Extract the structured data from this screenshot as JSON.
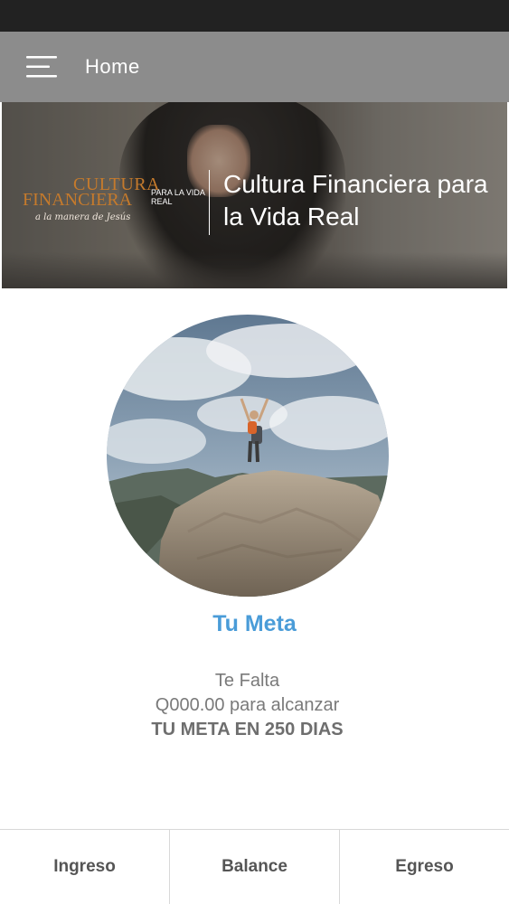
{
  "header": {
    "title": "Home",
    "menu_icon": "hamburger-menu-icon"
  },
  "banner": {
    "logo": {
      "line1": "CULTURA",
      "line2": "FINANCIERA",
      "line3": "PARA LA VIDA REAL",
      "tagline": "a la manera de Jesús"
    },
    "title": "Cultura Financiera para la Vida Real"
  },
  "goal": {
    "title": "Tu Meta",
    "line1": "Te Falta",
    "line2": "Q000.00 para alcanzar",
    "line3": "TU META EN 250 DIAS"
  },
  "bottom_nav": {
    "items": [
      {
        "label": "Ingreso"
      },
      {
        "label": "Balance"
      },
      {
        "label": "Egreso"
      }
    ]
  },
  "colors": {
    "app_bar": "#8c8c8c",
    "status_bar": "#222222",
    "accent": "#4a9cd8",
    "logo_orange": "#c57a2c"
  }
}
